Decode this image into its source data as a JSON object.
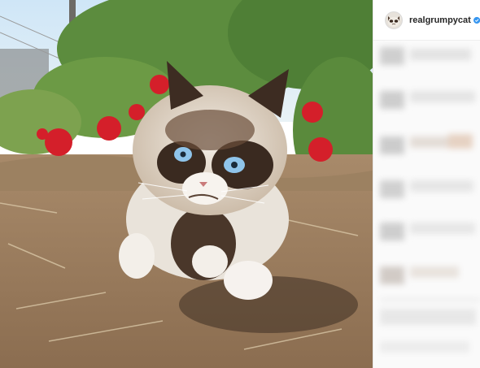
{
  "post": {
    "image_alt_subject": "cat",
    "account": {
      "username": "realgrumpycat",
      "verified": true,
      "avatar_icon": "cat-avatar-icon"
    }
  },
  "colors": {
    "verified_badge": "#3897f0",
    "username_text": "#262626",
    "sidebar_bg": "#ffffff"
  }
}
